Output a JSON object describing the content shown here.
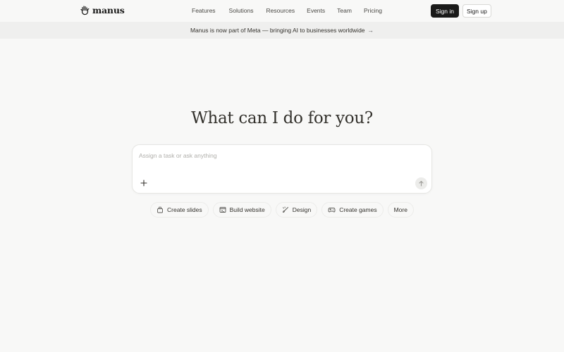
{
  "brand": {
    "name": "manus"
  },
  "nav": {
    "items": [
      {
        "label": "Features"
      },
      {
        "label": "Solutions"
      },
      {
        "label": "Resources"
      },
      {
        "label": "Events"
      },
      {
        "label": "Team"
      },
      {
        "label": "Pricing"
      }
    ],
    "sign_in": "Sign in",
    "sign_up": "Sign up"
  },
  "banner": {
    "text": "Manus is now part of Meta — bringing AI to businesses worldwide",
    "arrow": "→"
  },
  "hero": {
    "title": "What can I do for you?"
  },
  "composer": {
    "placeholder": "Assign a task or ask anything",
    "value": "",
    "plus_icon": "plus-icon",
    "send_icon": "arrow-up-icon"
  },
  "chips": [
    {
      "label": "Create slides",
      "icon": "slides-icon"
    },
    {
      "label": "Build website",
      "icon": "website-icon"
    },
    {
      "label": "Design",
      "icon": "design-icon"
    },
    {
      "label": "Create games",
      "icon": "gamepad-icon"
    },
    {
      "label": "More",
      "icon": ""
    }
  ],
  "colors": {
    "background": "#f8f8f7",
    "banner": "#efefee",
    "primary_button": "#1a1a19",
    "text": "#34322d"
  }
}
